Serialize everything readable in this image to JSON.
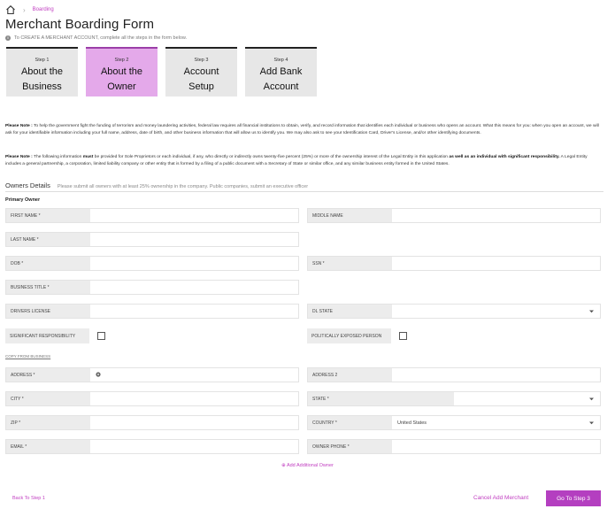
{
  "breadcrumb": {
    "current": "Boarding"
  },
  "page": {
    "title": "Merchant Boarding Form",
    "subtitle": "To CREATE A MERCHANT ACCOUNT, complete all the steps in the form below."
  },
  "steps": [
    {
      "num": "Step 1",
      "name_line1": "About the",
      "name_line2": "Business",
      "active": false
    },
    {
      "num": "Step 2",
      "name_line1": "About the",
      "name_line2": "Owner",
      "active": true
    },
    {
      "num": "Step 3",
      "name_line1": "Account",
      "name_line2": "Setup",
      "active": false
    },
    {
      "num": "Step 4",
      "name_line1": "Add Bank",
      "name_line2": "Account",
      "active": false
    }
  ],
  "notes": {
    "note1_prefix": "Please Note :",
    "note1_text": " To help the government fight the funding of terrorism and money laundering activities, federal law requires all financial institutions to obtain, verify, and record information that identifies each individual or business who opens an account. What this means for you: when you open an account, we will ask for your identifiable information including your full name, address, date of birth, and other business information that will allow us to identify you. We may also ask to see your Identification Card, Driver's License, and/or other identifying documents.",
    "note2_prefix": "Please Note :",
    "note2_a": " The following information ",
    "note2_must": "must",
    "note2_b": " be provided for Sole Proprietors or each individual, if any, who directly or indirectly owns twenty-five percent (25%) or more of the ownership interest of the Legal Entity in this application ",
    "note2_bold": "as well as an individual with significant responsibility.",
    "note2_c": " A Legal Entity includes a general partnership, a corporation, limited liability company or other entity that is formed by a filing of a public document with a Secretary of State or similar office, and any similar business entity formed in the United States."
  },
  "owners": {
    "title": "Owners Details",
    "description": "Please submit all owners with at least 25% ownership in the company. Public companies, submit an executive officer",
    "primary_label": "Primary Owner"
  },
  "fields": {
    "first_name": "FIRST NAME *",
    "middle_name": "MIDDLE NAME",
    "last_name": "LAST NAME *",
    "dob": "DOB *",
    "ssn": "SSN *",
    "business_title": "BUSINESS TITLE *",
    "drivers_license": "DRIVERS LICENSE",
    "dl_state": "DL STATE",
    "significant_responsibility": "SIGNIFICANT RESPONSIBILITY",
    "politically_exposed": "POLITICALLY EXPOSED PERSON",
    "copy_from_business": "COPY FROM BUSINESS",
    "address": "ADDRESS *",
    "address2": "ADDRESS 2",
    "city": "CITY *",
    "state": "STATE *",
    "zip": "ZIP *",
    "country": "COUNTRY *",
    "country_value": "United States",
    "email": "EMAIL *",
    "owner_phone": "OWNER PHONE *"
  },
  "actions": {
    "add_owner": "⊕ Add Additional Owner",
    "back": "Back To Step 1",
    "cancel": "Cancel Add Merchant",
    "next": "Go To Step 3"
  },
  "colors": {
    "accent": "#c13fc1",
    "active_step": "#e4a9ea",
    "button": "#b43fc0"
  },
  "icons": [
    "home-icon",
    "chevron-right-icon",
    "info-icon",
    "chevron-down-icon",
    "location-pin-icon"
  ]
}
